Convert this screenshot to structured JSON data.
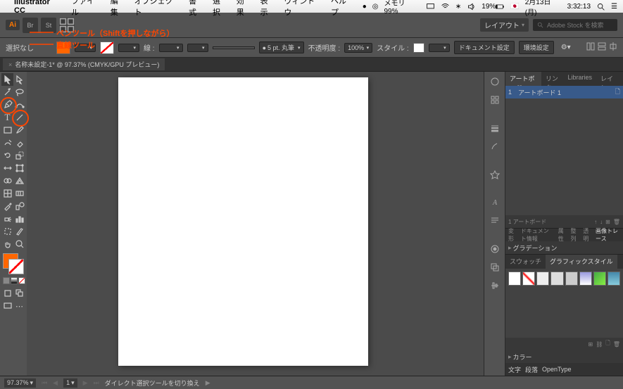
{
  "menubar": {
    "app": "Illustrator CC",
    "items": [
      "ファイル",
      "編集",
      "オブジェクト",
      "書式",
      "選択",
      "効果",
      "表示",
      "ウィンドウ",
      "ヘルプ"
    ],
    "mem": "メモリ 99%",
    "battery": "19%",
    "date": "2月13日(月)",
    "time": "3:32:13"
  },
  "appbar": {
    "ai": "Ai",
    "br": "Br",
    "st": "St",
    "layout": "レイアウト",
    "search_placeholder": "Adobe Stock を検索"
  },
  "ctrlbar": {
    "nosel": "選択なし",
    "stroke_label": "線 :",
    "stroke_val": "",
    "brush": "5 pt. 丸筆",
    "opacity_label": "不透明度 :",
    "opacity_val": "100%",
    "style_label": "スタイル :",
    "doc_settings": "ドキュメント設定",
    "env_settings": "環境設定"
  },
  "tab": {
    "title": "名称未設定-1* @ 97.37% (CMYK/GPU プレビュー)"
  },
  "layers": {
    "tabs": [
      "アートボード",
      "リンク",
      "Libraries",
      "レイヤー"
    ],
    "item_num": "1",
    "item_name": "アートボード 1",
    "count": "1 アートボード"
  },
  "info_tabs": [
    "変形",
    "ドキュメント情報",
    "属性",
    "整列",
    "透明",
    "画像トレース"
  ],
  "grad_tab": "グラデーション",
  "style_tabs": [
    "スウォッチ",
    "グラフィックスタイル"
  ],
  "bottom_accordions": {
    "color": "カラー",
    "text": "文字",
    "para": "段落",
    "ot": "OpenType"
  },
  "status": {
    "zoom": "97.37%",
    "ab": "1",
    "hint": "ダイレクト選択ツールを切り換え"
  },
  "annotations": {
    "pen": "ペンツール（Shiftを押しながら）",
    "line": "直線ツール"
  }
}
